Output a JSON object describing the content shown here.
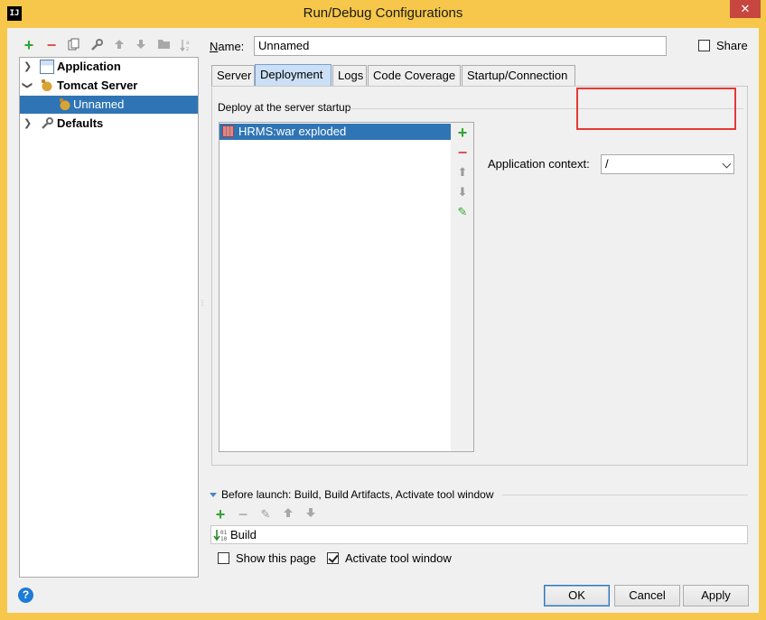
{
  "window": {
    "title": "Run/Debug Configurations",
    "app_icon_text": "IJ",
    "close_glyph": "✕"
  },
  "toolbar": {
    "add": "+",
    "remove": "−"
  },
  "tree": {
    "items": [
      {
        "label": "Application",
        "icon": "application-icon",
        "expanded": false
      },
      {
        "label": "Tomcat Server",
        "icon": "tomcat-icon",
        "expanded": true
      },
      {
        "label": "Unnamed",
        "icon": "tomcat-icon",
        "selected": true
      },
      {
        "label": "Defaults",
        "icon": "wrench-icon",
        "expanded": false
      }
    ]
  },
  "name": {
    "label_prefix": "N",
    "label_rest": "ame:",
    "value": "Unnamed"
  },
  "share": {
    "label": "Share",
    "checked": false
  },
  "tabs": [
    {
      "label": "Server"
    },
    {
      "label": "Deployment",
      "active": true
    },
    {
      "label": "Logs"
    },
    {
      "label": "Code Coverage"
    },
    {
      "label": "Startup/Connection"
    }
  ],
  "deployment": {
    "group_title": "Deploy at the server startup",
    "items": [
      {
        "label": "HRMS:war exploded",
        "selected": true
      }
    ],
    "side_tools": {
      "add": "+",
      "remove": "−",
      "up": "⬆",
      "down": "⬇",
      "edit": "✎"
    }
  },
  "context": {
    "label": "Application context:",
    "value": "/"
  },
  "before_launch": {
    "title": "Before launch: Build, Build Artifacts, Activate tool window",
    "items": [
      {
        "label": "Build"
      }
    ]
  },
  "options": {
    "show_page": {
      "label": "Show this page",
      "checked": false
    },
    "activate_tool": {
      "label": "Activate tool window",
      "checked": true
    }
  },
  "help_label": "?",
  "buttons": {
    "ok": "OK",
    "cancel": "Cancel",
    "apply": "Apply"
  },
  "colors": {
    "accent": "#2f75b5",
    "frame": "#f6c74a",
    "highlight": "#e53935"
  }
}
